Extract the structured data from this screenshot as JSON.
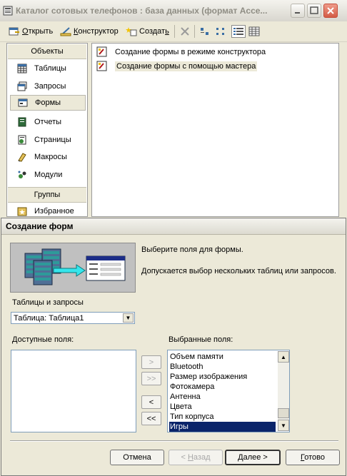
{
  "db_window": {
    "title": "Каталог сотовых телефонов : база данных (формат Acce...",
    "toolbar": {
      "open_label": "Открыть",
      "open_hotkey": "О",
      "constructor_label": "Конструктор",
      "constructor_hotkey": "К",
      "create_label": "Создать",
      "create_hotkey": "ь"
    },
    "nav": {
      "objects_header": "Объекты",
      "items": [
        {
          "label": "Таблицы",
          "icon": "table-icon"
        },
        {
          "label": "Запросы",
          "icon": "query-icon"
        },
        {
          "label": "Формы",
          "icon": "form-icon"
        },
        {
          "label": "Отчеты",
          "icon": "report-icon"
        },
        {
          "label": "Страницы",
          "icon": "page-icon"
        },
        {
          "label": "Макросы",
          "icon": "macro-icon"
        },
        {
          "label": "Модули",
          "icon": "module-icon"
        }
      ],
      "groups_header": "Группы",
      "group_items": [
        {
          "label": "Избранное",
          "icon": "favorites-icon"
        }
      ]
    },
    "objects": [
      "Создание формы в режиме конструктора",
      "Создание формы с помощью мастера"
    ]
  },
  "dialog": {
    "title": "Создание форм",
    "hint1": "Выберите поля для формы.",
    "hint2": "Допускается выбор нескольких таблиц или запросов.",
    "tables_label": "Таблицы и запросы",
    "tables_value": "Таблица: Таблица1",
    "available_label": "Доступные поля:",
    "selected_label": "Выбранные поля:",
    "selected_fields": [
      "Объем памяти",
      "Bluetooth",
      "Размер изображения",
      "Фотокамера",
      "Антенна",
      "Цвета",
      "Тип корпуса",
      "Игры"
    ],
    "selected_index": 7,
    "move_buttons": {
      "add_one": ">",
      "add_all": ">>",
      "remove_one": "<",
      "remove_all": "<<"
    },
    "buttons": {
      "cancel": "Отмена",
      "back": "< Назад",
      "next": "Далее >",
      "finish": "Готово"
    }
  },
  "colors": {
    "selection": "#0a246a",
    "face": "#ece9d8"
  }
}
